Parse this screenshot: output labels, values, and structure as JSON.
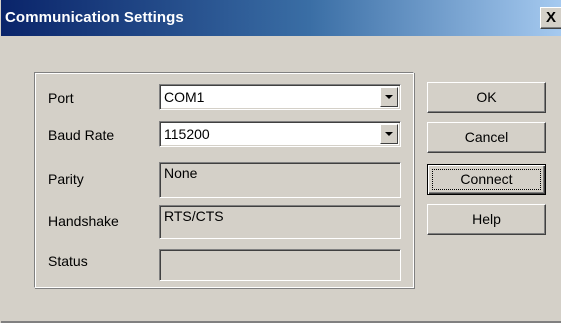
{
  "window": {
    "title": "Communication Settings",
    "close_glyph": "X"
  },
  "form": {
    "port": {
      "label": "Port",
      "value": "COM1"
    },
    "baud_rate": {
      "label": "Baud Rate",
      "value": "115200"
    },
    "parity": {
      "label": "Parity",
      "value": "None"
    },
    "handshake": {
      "label": "Handshake",
      "value": "RTS/CTS"
    },
    "status": {
      "label": "Status",
      "value": ""
    }
  },
  "buttons": {
    "ok": "OK",
    "cancel": "Cancel",
    "connect": "Connect",
    "help": "Help"
  },
  "colors": {
    "titlebar_start": "#0a246a",
    "titlebar_end": "#a6caf0",
    "face": "#d4d0c8"
  }
}
